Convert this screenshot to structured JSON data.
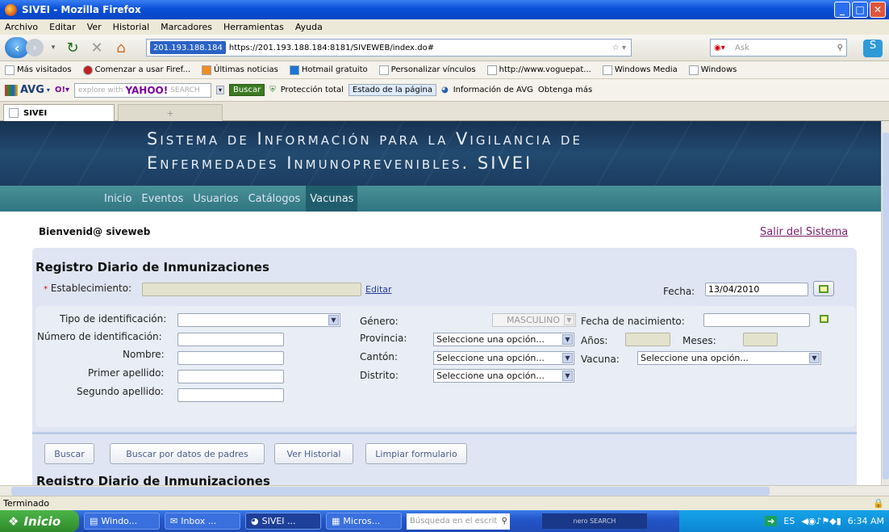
{
  "window": {
    "title": "SIVEI - Mozilla Firefox"
  },
  "menu": [
    "Archivo",
    "Editar",
    "Ver",
    "Historial",
    "Marcadores",
    "Herramientas",
    "Ayuda"
  ],
  "nav": {
    "site_badge": "201.193.188.184",
    "url": "https://201.193.188.184:8181/SIVEWEB/index.do#",
    "search_placeholder": "Ask"
  },
  "bookmarks": [
    "Más visitados",
    "Comenzar a usar Firef...",
    "Últimas noticias",
    "Hotmail gratuito",
    "Personalizar vínculos",
    "http://www.voguepat...",
    "Windows Media",
    "Windows"
  ],
  "avg": {
    "logo": "AVG",
    "search_prefix": "explore with",
    "yahoo": "YAHOO!",
    "search_label": "SEARCH",
    "buscar": "Buscar",
    "proteccion": "Protección total",
    "estado": "Estado de la página",
    "info": "Información de AVG",
    "mas": "Obtenga más"
  },
  "tab": {
    "title": "SIVEI",
    "new_tab": "+"
  },
  "header": {
    "line1": "Sistema de Información para la Vigilancia de",
    "line2": "Enfermedades Inmunoprevenibles. SIVEI"
  },
  "appnav": [
    "Inicio",
    "Eventos",
    "Usuarios",
    "Catálogos",
    "Vacunas"
  ],
  "welcome": "Bienvenid@ siveweb",
  "logout": "Salir del Sistema",
  "form": {
    "title": "Registro Diario de Inmunizaciones",
    "establecimiento_label": "Establecimiento:",
    "editar": "Editar",
    "fecha_label": "Fecha:",
    "fecha_value": "13/04/2010",
    "tipo_id_label": "Tipo de identificación:",
    "num_id_label": "Número de identificación:",
    "nombre_label": "Nombre:",
    "primer_apellido_label": "Primer apellido:",
    "segundo_apellido_label": "Segundo apellido:",
    "genero_label": "Género:",
    "genero_value": "MASCULINO",
    "provincia_label": "Provincia:",
    "canton_label": "Cantón:",
    "distrito_label": "Distrito:",
    "select_placeholder": "Seleccione una opción...",
    "fecha_nac_label": "Fecha de nacimiento:",
    "anos_label": "Años:",
    "meses_label": "Meses:",
    "vacuna_label": "Vacuna:",
    "vacuna_value": "Seleccione una opción..."
  },
  "buttons": {
    "buscar": "Buscar",
    "buscar_padres": "Buscar por datos de padres",
    "historial": "Ver Historial",
    "limpiar": "Limpiar formulario"
  },
  "section2_title": "Registro Diario de Inmunizaciones",
  "status": "Terminado",
  "taskbar": {
    "start": "Inicio",
    "items": [
      "Windo...",
      "Inbox ...",
      "SIVEI ...",
      "Micros..."
    ],
    "search_placeholder": "Búsqueda en el escrit",
    "nero": "nero SEARCH",
    "lang": "ES",
    "time": "6:34 AM"
  }
}
